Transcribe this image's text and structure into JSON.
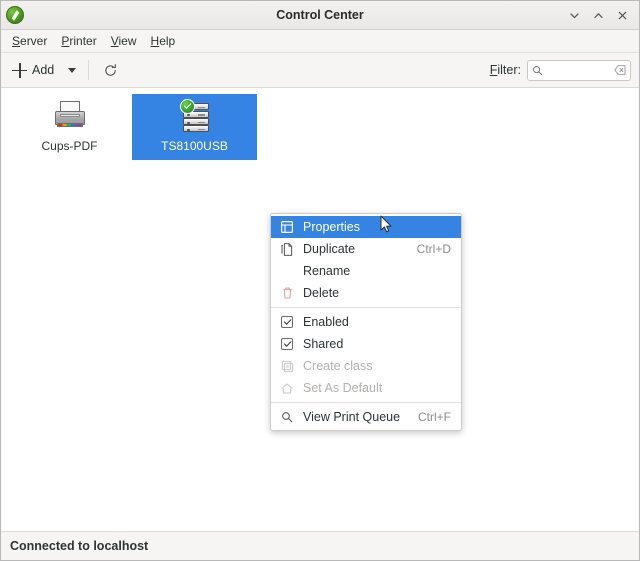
{
  "window": {
    "title": "Control Center",
    "app_icon": "app-logo-icon",
    "controls": [
      {
        "name": "minimize-button",
        "icon": "chevron-down-icon"
      },
      {
        "name": "maximize-button",
        "icon": "chevron-up-icon"
      },
      {
        "name": "close-button",
        "icon": "close-icon"
      }
    ]
  },
  "menubar": {
    "items": [
      {
        "label": "Server",
        "mnemonic": "S"
      },
      {
        "label": "Printer",
        "mnemonic": "P"
      },
      {
        "label": "View",
        "mnemonic": "V"
      },
      {
        "label": "Help",
        "mnemonic": "H"
      }
    ]
  },
  "toolbar": {
    "add_label": "Add",
    "add_icon": "plus-icon",
    "add_dropdown_icon": "caret-down-icon",
    "refresh_icon": "refresh-icon",
    "filter_label": "Filter:",
    "filter_mnemonic": "F",
    "filter_value": "",
    "filter_placeholder": "",
    "filter_search_icon": "search-icon",
    "filter_clear_icon": "clear-entry-icon"
  },
  "printers": [
    {
      "name": "Cups-PDF",
      "icon": "printer-icon",
      "selected": false
    },
    {
      "name": "TS8100USB",
      "icon": "printer-server-stack-icon",
      "badge": "enabled-check-badge-icon",
      "selected": true
    }
  ],
  "context_menu": {
    "items": [
      {
        "label": "Properties",
        "accel": "",
        "icon": "properties-icon",
        "state": "highlight"
      },
      {
        "label": "Duplicate",
        "accel": "Ctrl+D",
        "icon": "duplicate-icon",
        "state": "normal"
      },
      {
        "label": "Rename",
        "accel": "",
        "icon": "",
        "state": "normal"
      },
      {
        "label": "Delete",
        "accel": "",
        "icon": "trash-icon",
        "state": "normal"
      },
      {
        "separator": true
      },
      {
        "label": "Enabled",
        "accel": "",
        "icon": "checkbox-checked",
        "state": "normal"
      },
      {
        "label": "Shared",
        "accel": "",
        "icon": "checkbox-checked",
        "state": "normal"
      },
      {
        "label": "Create class",
        "accel": "",
        "icon": "create-class-icon",
        "state": "disabled"
      },
      {
        "label": "Set As Default",
        "accel": "",
        "icon": "home-icon",
        "state": "disabled"
      },
      {
        "separator": true
      },
      {
        "label": "View Print Queue",
        "accel": "Ctrl+F",
        "icon": "search-icon",
        "state": "normal"
      }
    ]
  },
  "statusbar": {
    "text": "Connected to localhost"
  },
  "colors": {
    "accent": "#3584e4",
    "chrome": "#f6f5f4",
    "text": "#2e3436",
    "disabled_text": "#b4b2af",
    "badge_green": "#33a02c"
  }
}
